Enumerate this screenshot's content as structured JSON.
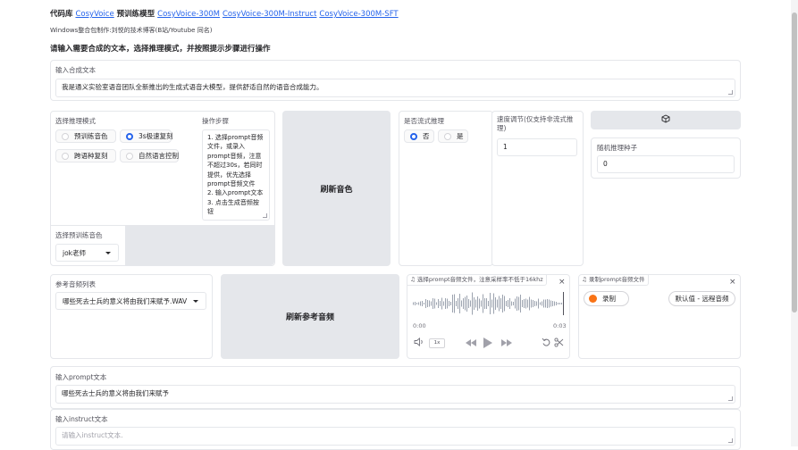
{
  "header": {
    "prefix": "代码库",
    "repo_link": "CosyVoice",
    "models_prefix": "预训练模型",
    "model_links": [
      "CosyVoice-300M",
      "CosyVoice-300M-Instruct",
      "CosyVoice-300M-SFT"
    ],
    "credit": "Windows整合包制作:刘悦的技术博客(B站/Youtube 同名)",
    "instruction": "请输入需要合成的文本，选择推理模式，并按照提示步骤进行操作"
  },
  "tts_text": {
    "label": "输入合成文本",
    "value": "我是通义实验室语音团队全新推出的生成式语音大模型，提供舒适自然的语音合成能力。"
  },
  "mode": {
    "label": "选择推理模式",
    "options": [
      "预训练音色",
      "3s极速复刻",
      "跨语种复刻",
      "自然语言控制"
    ],
    "selected": "3s极速复刻"
  },
  "steps": {
    "label": "操作步骤",
    "text": [
      "1. 选择prompt音频",
      "文件，或录入",
      "prompt音频，注意",
      "不超过30s，若同时",
      "提供，优先选择",
      "prompt音频文件",
      "2. 输入prompt文本",
      "3. 点击生成音频按",
      "钮"
    ]
  },
  "refresh_voice_button": "刷新音色",
  "stream": {
    "label": "是否流式推理",
    "options": [
      "否",
      "是"
    ],
    "selected": "否"
  },
  "speed": {
    "label": "速度调节(仅支持非流式推理)",
    "value": "1"
  },
  "dice_icon": "cube-icon",
  "seed": {
    "label": "随机推理种子",
    "value": "0"
  },
  "pretrained_voice": {
    "label": "选择预训练音色",
    "value": "jok老师"
  },
  "ref_audio": {
    "label": "参考音频列表",
    "value": "哪些死去士兵的意义将由我们来赋予.WAV"
  },
  "refresh_ref_button": "刷新参考音频",
  "prompt_audio": {
    "label": "选择prompt音频文件，注意采样率不低于16khz",
    "time_start": "0:00",
    "time_end": "0:03",
    "speed": "1x"
  },
  "record": {
    "label": "录制prompt音频文件",
    "record_button": "录制",
    "default_button": "默认值 - 远程音频"
  },
  "prompt_text": {
    "label": "输入prompt文本",
    "value": "哪些死去士兵的意义将由我们来赋予"
  },
  "instruct_text": {
    "label": "输入instruct文本",
    "placeholder": "请输入instruct文本."
  },
  "colors": {
    "accent": "#2563eb",
    "record": "#f97316",
    "waveform": "#9ca3af"
  }
}
